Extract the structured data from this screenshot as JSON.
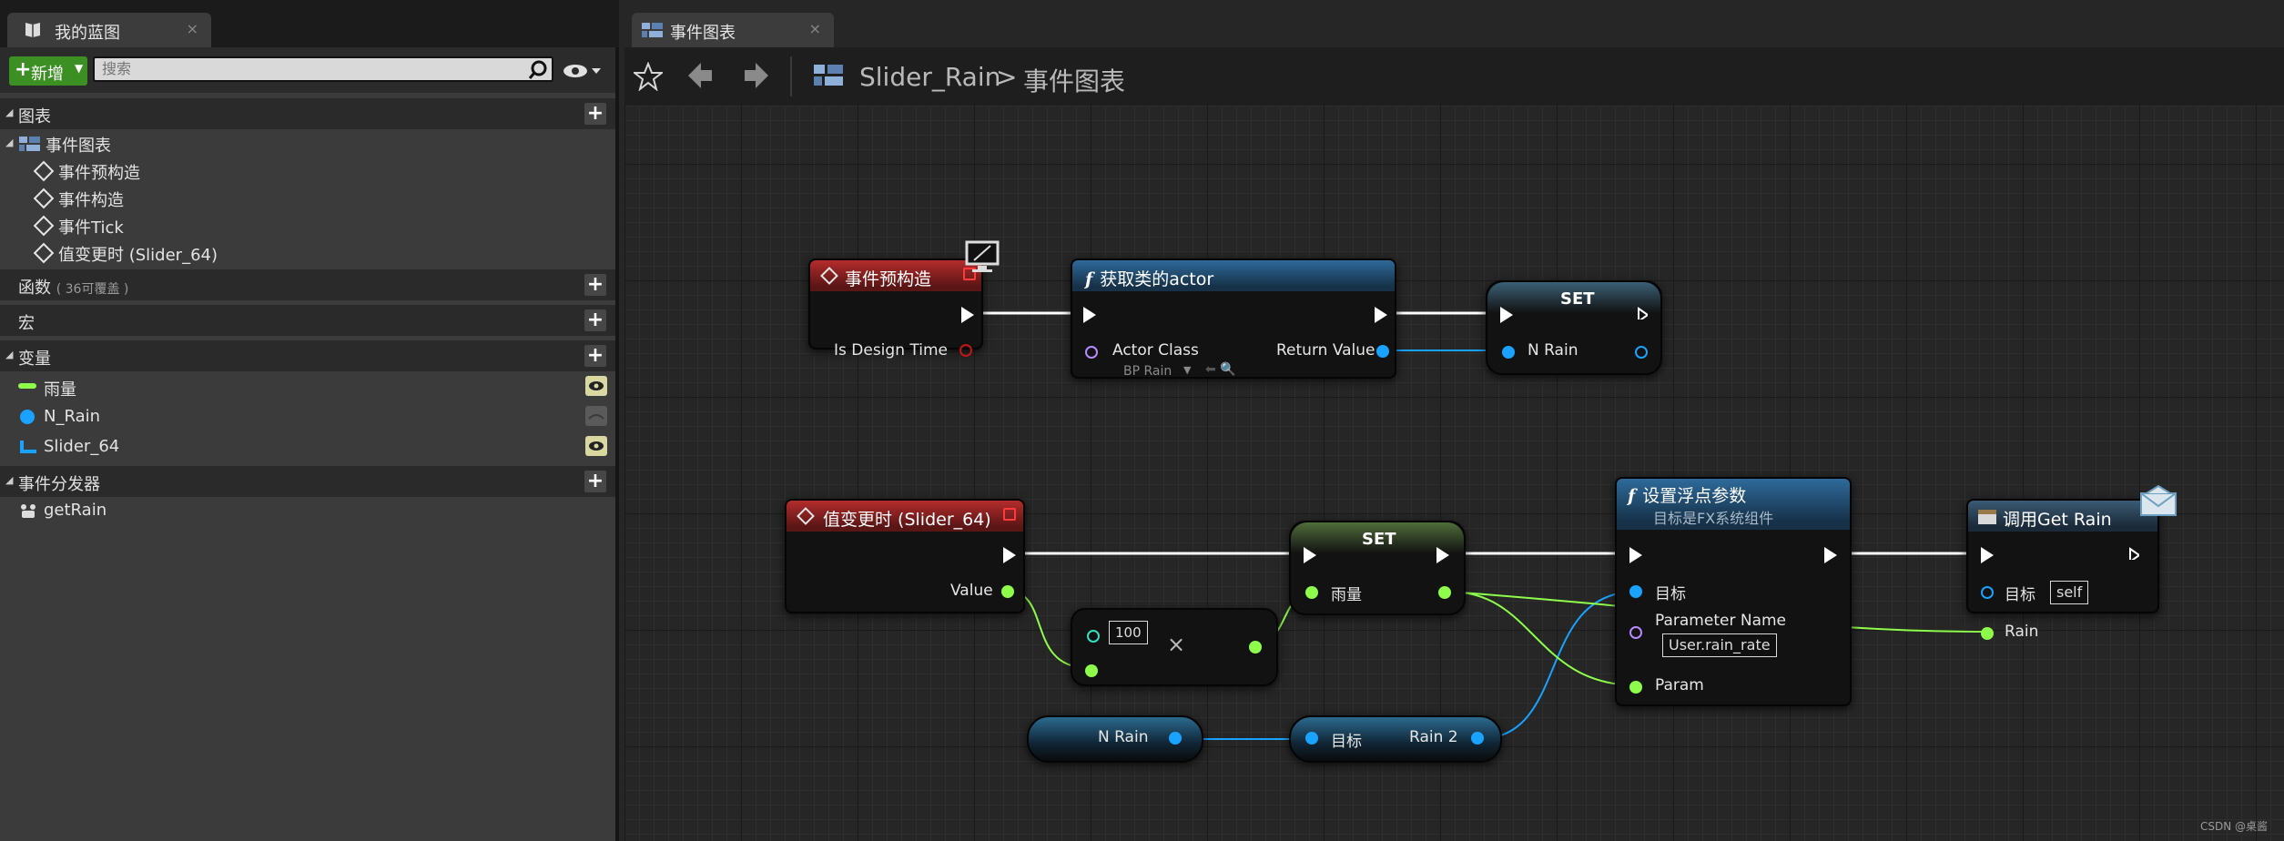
{
  "left_tab": {
    "title": "我的蓝图"
  },
  "toolbar": {
    "add_label": "新增",
    "search_placeholder": "搜索"
  },
  "sections": {
    "graphs": {
      "label": "图表"
    },
    "event_graph": {
      "label": "事件图表"
    },
    "events": [
      "事件预构造",
      "事件构造",
      "事件Tick",
      "值变更时 (Slider_64)"
    ],
    "functions": {
      "label": "函数",
      "sub": "( 36可覆盖 )"
    },
    "macros": {
      "label": "宏"
    },
    "variables": {
      "label": "变量",
      "items": [
        "雨量",
        "N_Rain",
        "Slider_64"
      ]
    },
    "dispatchers": {
      "label": "事件分发器",
      "items": [
        "getRain"
      ]
    }
  },
  "graph_tab": {
    "title": "事件图表"
  },
  "breadcrumb": {
    "blueprint": "Slider_Rain",
    "sep": ">",
    "graph": "事件图表"
  },
  "nodes": {
    "preconstruct": {
      "title": "事件预构造",
      "pin": "Is Design Time"
    },
    "get_actor": {
      "title": "获取类的actor",
      "ftag": "f",
      "actor_class": "Actor Class",
      "class_value": "BP Rain",
      "return_value": "Return Value"
    },
    "set1": {
      "title": "SET",
      "pin": "N Rain"
    },
    "value_changed": {
      "title": "值变更时 (Slider_64)",
      "pin": "Value"
    },
    "multiply": {
      "value": "100",
      "op": "×"
    },
    "set2": {
      "title": "SET",
      "pin": "雨量"
    },
    "set_float": {
      "title": "设置浮点参数",
      "ftag": "f",
      "subtitle": "目标是FX系统组件",
      "target": "目标",
      "param_name": "Parameter Name",
      "param_name_value": "User.rain_rate",
      "param": "Param"
    },
    "call_get_rain": {
      "title": "调用Get Rain",
      "target": "目标",
      "target_value": "self",
      "rain": "Rain"
    },
    "n_rain_var": {
      "label": "N Rain"
    },
    "rain2_getter": {
      "target": "目标",
      "out": "Rain 2"
    }
  },
  "watermark": "CSDN @桌酱",
  "colors": {
    "exec": "#ffffff",
    "object": "#19a2ff",
    "float": "#8dfc4a",
    "event_header": "#b42c2c",
    "function_header": "#2e6a9a",
    "add_button": "#3c8f23"
  }
}
